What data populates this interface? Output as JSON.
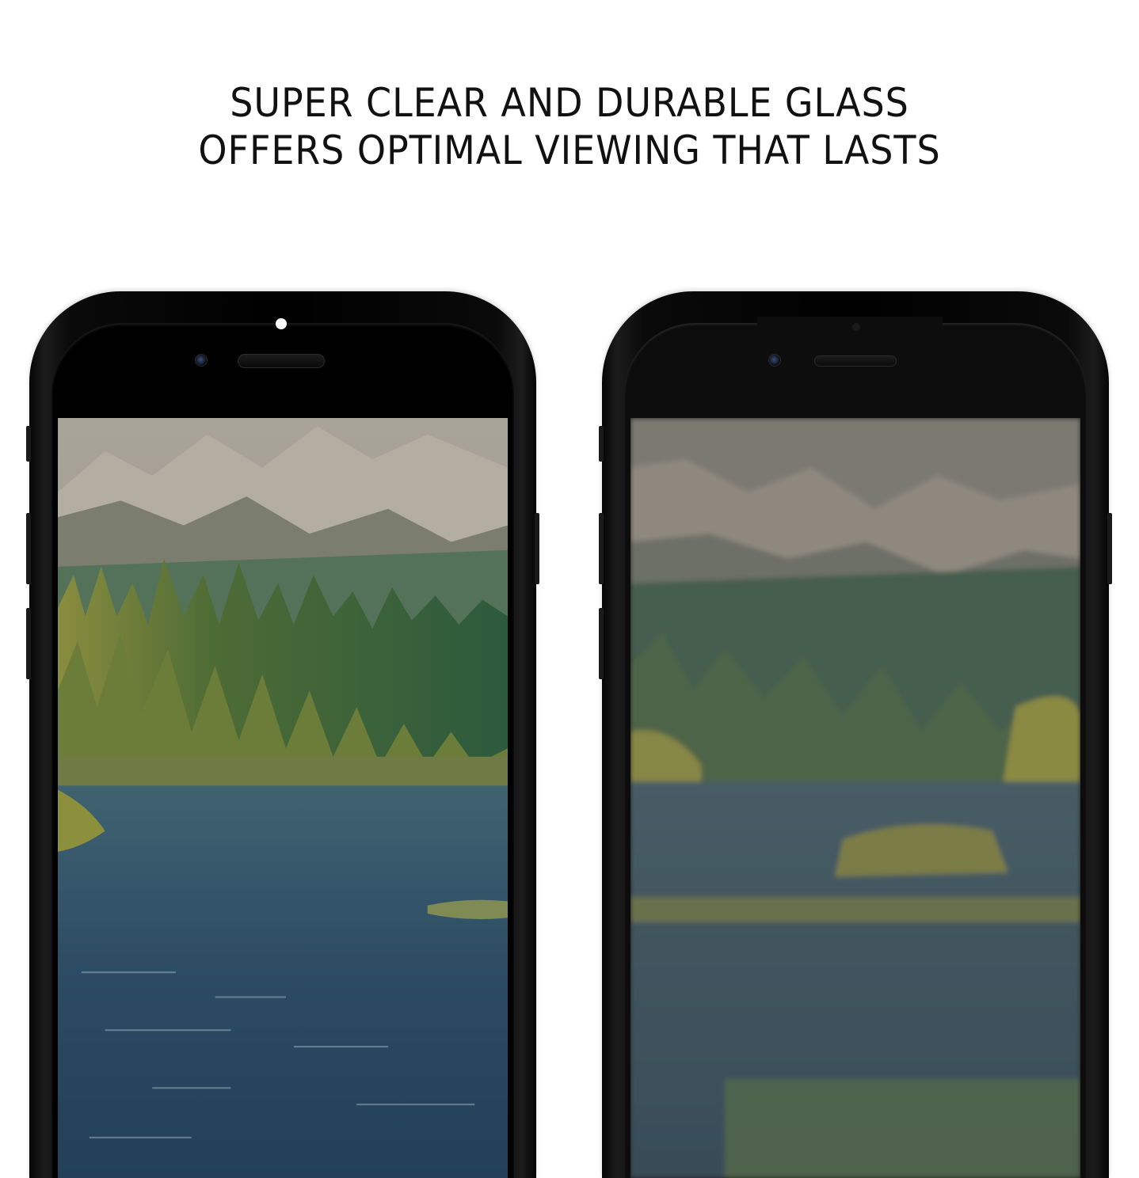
{
  "headline": {
    "line1": "SUPER CLEAR AND DURABLE GLASS",
    "line2": "OFFERS OPTIMAL VIEWING THAT LASTS"
  },
  "phones": [
    {
      "name": "clear-glass-phone",
      "screen_image": "mountain-lake-forest-clear"
    },
    {
      "name": "hazy-glass-phone",
      "screen_image": "mountain-lake-forest-blurred"
    }
  ],
  "colors": {
    "background": "#ffffff",
    "headline_text": "#111111",
    "phone_body": "#000000",
    "water": "#2c4d66",
    "forest": "#2f5b3a",
    "mountain": "#9a9890"
  }
}
